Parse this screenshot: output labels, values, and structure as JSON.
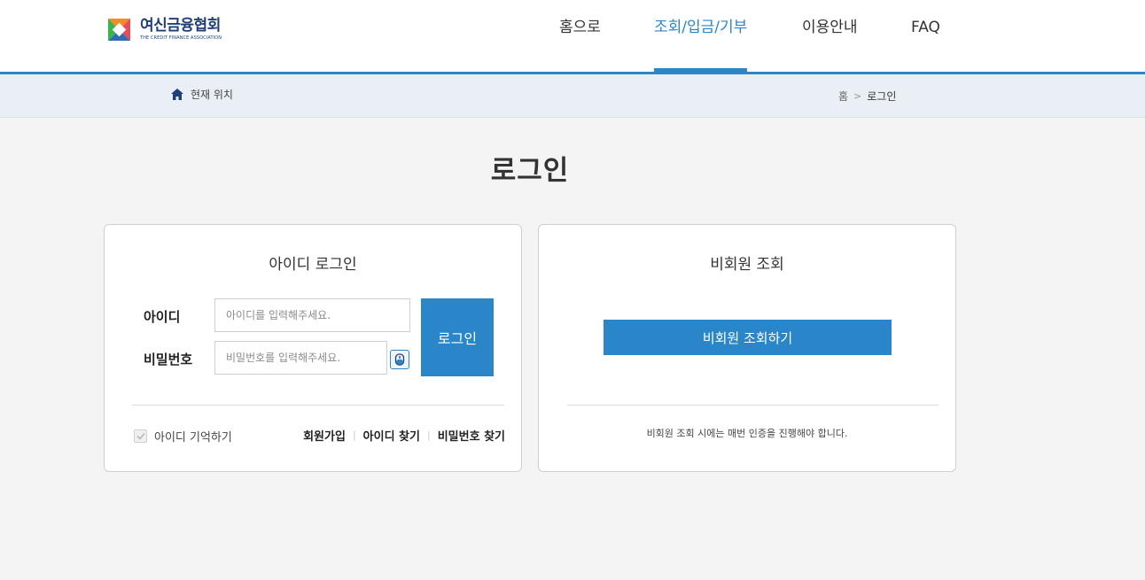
{
  "logo": {
    "name_ko": "여신금융협회",
    "name_en": "THE CREDIT FINANCE ASSOCIATION"
  },
  "nav": {
    "items": [
      {
        "label": "홈으로",
        "active": false
      },
      {
        "label": "조회/입금/기부",
        "active": true
      },
      {
        "label": "이용안내",
        "active": false
      },
      {
        "label": "FAQ",
        "active": false
      }
    ]
  },
  "breadcrumb": {
    "location_label": "현재 위치",
    "home": "홈",
    "separator": ">",
    "current": "로그인"
  },
  "page": {
    "title": "로그인"
  },
  "id_login": {
    "title": "아이디 로그인",
    "id_label": "아이디",
    "id_placeholder": "아이디를 입력해주세요.",
    "pw_label": "비밀번호",
    "pw_placeholder": "비밀번호를 입력해주세요.",
    "login_button": "로그인",
    "remember_label": "아이디 기억하기",
    "links": {
      "signup": "회원가입",
      "find_id": "아이디 찾기",
      "find_pw": "비밀번호 찾기"
    }
  },
  "guest": {
    "title": "비회원 조회",
    "button": "비회원 조회하기",
    "note": "비회원 조회 시에는 매번 인증을 진행해야 합니다."
  },
  "colors": {
    "accent": "#2a86c8",
    "brand_navy": "#1f3f7a",
    "background": "#f4f4f4",
    "crumb_bg": "#eaeef5"
  },
  "icons": {
    "home": "home-icon",
    "keyboard": "virtual-keyboard-icon",
    "check": "check-icon"
  }
}
